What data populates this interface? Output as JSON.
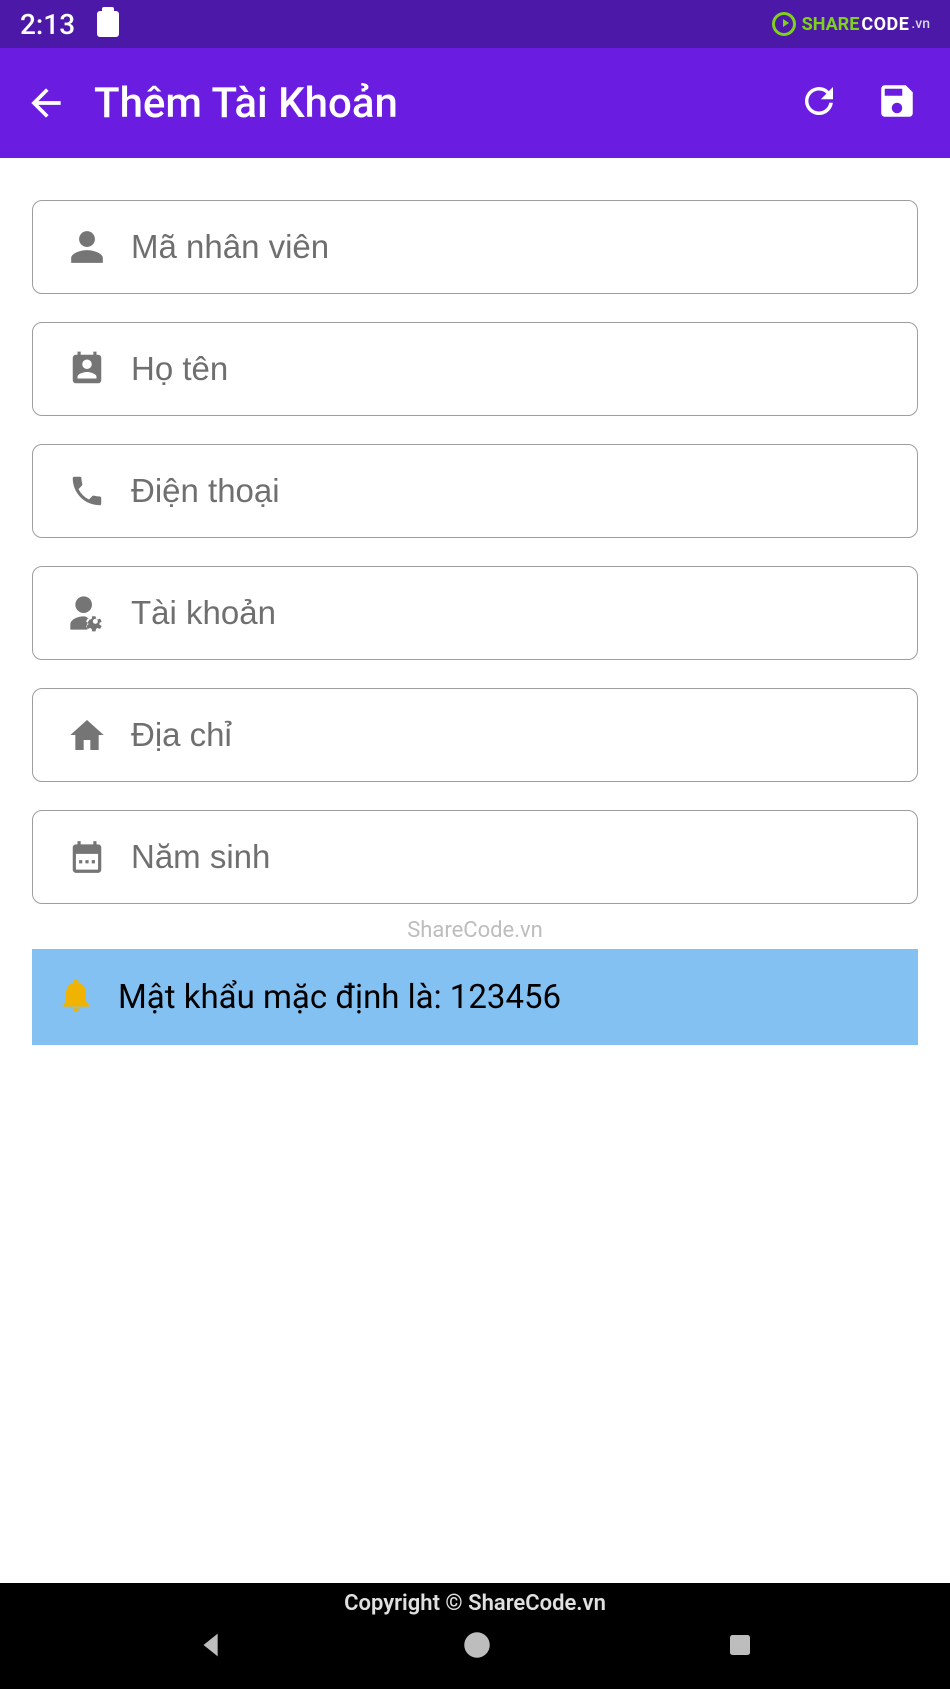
{
  "status": {
    "time": "2:13"
  },
  "sharecode": {
    "brand_green": "SHARE",
    "brand_white": "CODE",
    "suffix": ".vn"
  },
  "appbar": {
    "title": "Thêm Tài Khoản"
  },
  "fields": {
    "employee_id": {
      "placeholder": "Mã nhân viên",
      "value": ""
    },
    "fullname": {
      "placeholder": "Họ tên",
      "value": ""
    },
    "phone": {
      "placeholder": "Điện thoại",
      "value": ""
    },
    "account": {
      "placeholder": "Tài khoản",
      "value": ""
    },
    "address": {
      "placeholder": "Địa chỉ",
      "value": ""
    },
    "birthyear": {
      "placeholder": "Năm sinh",
      "value": ""
    }
  },
  "watermark": "ShareCode.vn",
  "notice": {
    "text": "Mật khẩu mặc định là: 123456"
  },
  "footer": {
    "copyright": "Copyright © ShareCode.vn"
  }
}
